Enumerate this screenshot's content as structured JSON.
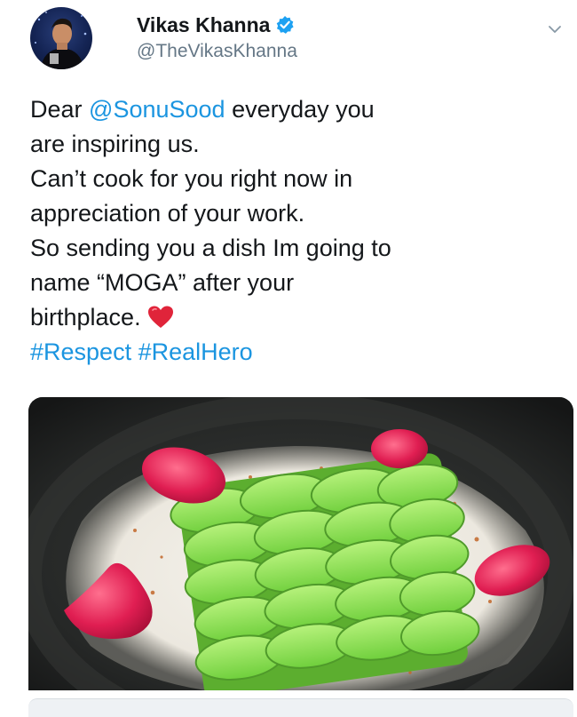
{
  "tweet": {
    "author": {
      "display_name": "Vikas Khanna",
      "handle": "@TheVikasKhanna",
      "verified": true
    },
    "text_lines": [
      {
        "before": "Dear ",
        "mention": "@SonuSood",
        "after": " everyday you"
      },
      "are inspiring us.",
      "Can’t cook for you right now in",
      "appreciation of your work.",
      "So sending you a dish Im going to",
      "name “MOGA” after your",
      "birthplace."
    ],
    "emoji": "red-heart",
    "hashtags": "#Respect #RealHero",
    "media": {
      "kind": "photo",
      "subject": "cucumber-dish"
    }
  },
  "colors": {
    "link": "#1b95e0",
    "verified": "#1da1f2",
    "text": "#14171a",
    "secondary": "#657786"
  }
}
